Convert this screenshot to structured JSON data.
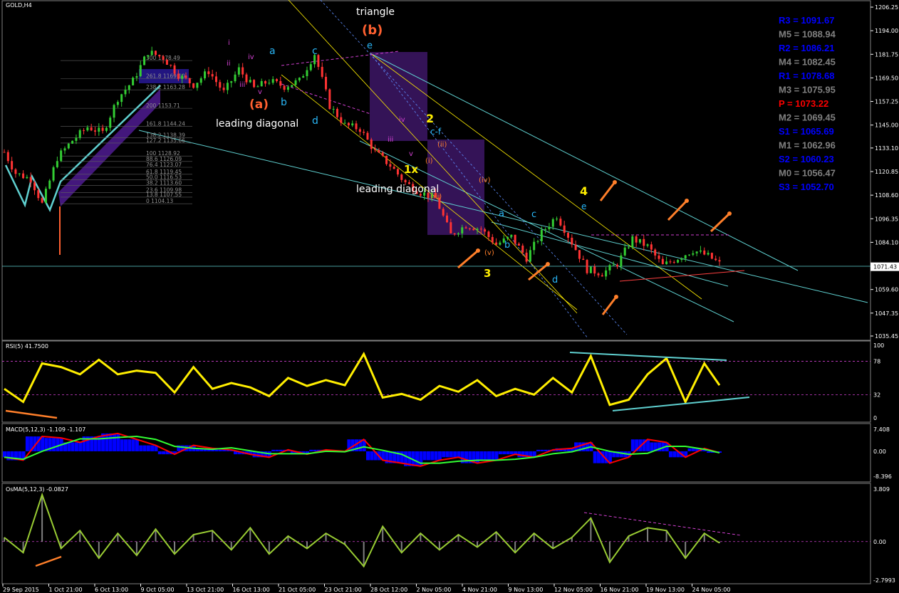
{
  "symbol": "GOLD,H4",
  "colors": {
    "bull": "#33cc33",
    "bear": "#ff3333",
    "rsi": "#ffee00",
    "macd_hist": "#0000ff",
    "macd_main": "#ff0000",
    "macd_signal": "#33ff33",
    "osma": "#99cc33",
    "pivot_r": "#0000ff",
    "pivot_m": "#808080",
    "pivot_p": "#ff0000",
    "channel": "#5fd0d0",
    "arrow": "#ff7f2a"
  },
  "chart_data": [
    {
      "type": "candlestick",
      "title": "GOLD,H4",
      "ylim": [
        1031,
        1210
      ],
      "y_ticks": [
        "1206.25",
        "1194.00",
        "1181.75",
        "1169.50",
        "1157.25",
        "1145.00",
        "1133.10",
        "1120.85",
        "1108.60",
        "1096.35",
        "1084.10",
        "1071.43",
        "1059.60",
        "1047.35",
        "1035.45"
      ],
      "current_price": "1071.43",
      "x_ticks": [
        "29 Sep 2015",
        "1 Oct 21:00",
        "6 Oct 13:00",
        "9 Oct 05:00",
        "13 Oct 21:00",
        "16 Oct 13:00",
        "21 Oct 05:00",
        "23 Oct 21:00",
        "28 Oct 12:00",
        "2 Nov 05:00",
        "4 Nov 21:00",
        "9 Nov 13:00",
        "12 Nov 05:00",
        "16 Nov 21:00",
        "19 Nov 13:00",
        "24 Nov 05:00"
      ],
      "close_path": [
        [
          0,
          1131
        ],
        [
          3,
          1120
        ],
        [
          7,
          1117
        ],
        [
          10,
          1104
        ],
        [
          14,
          1128
        ],
        [
          18,
          1137
        ],
        [
          22,
          1144
        ],
        [
          26,
          1141
        ],
        [
          30,
          1159
        ],
        [
          34,
          1168
        ],
        [
          38,
          1183
        ],
        [
          42,
          1180
        ],
        [
          46,
          1171
        ],
        [
          50,
          1166
        ],
        [
          54,
          1173
        ],
        [
          58,
          1162
        ],
        [
          62,
          1174
        ],
        [
          66,
          1164
        ],
        [
          70,
          1168
        ],
        [
          74,
          1165
        ],
        [
          78,
          1168
        ],
        [
          82,
          1182
        ],
        [
          86,
          1155
        ],
        [
          90,
          1145
        ],
        [
          94,
          1143
        ],
        [
          98,
          1131
        ],
        [
          102,
          1124
        ],
        [
          106,
          1115
        ],
        [
          110,
          1110
        ],
        [
          114,
          1107
        ],
        [
          118,
          1088
        ],
        [
          122,
          1093
        ],
        [
          126,
          1091
        ],
        [
          130,
          1083
        ],
        [
          134,
          1087
        ],
        [
          138,
          1076
        ],
        [
          142,
          1089
        ],
        [
          146,
          1098
        ],
        [
          150,
          1084
        ],
        [
          154,
          1070
        ],
        [
          158,
          1068
        ],
        [
          162,
          1073
        ],
        [
          166,
          1086
        ],
        [
          170,
          1082
        ],
        [
          174,
          1072
        ],
        [
          178,
          1076
        ],
        [
          182,
          1080
        ],
        [
          186,
          1077
        ],
        [
          189,
          1073
        ]
      ],
      "pivots": [
        {
          "label": "R3 = 1091.67",
          "kind": "r"
        },
        {
          "label": "M5 = 1088.94",
          "kind": "m"
        },
        {
          "label": "R2 = 1086.21",
          "kind": "r"
        },
        {
          "label": "M4 = 1082.45",
          "kind": "m"
        },
        {
          "label": "R1 = 1078.68",
          "kind": "r"
        },
        {
          "label": "M3 = 1075.95",
          "kind": "m"
        },
        {
          "label": "P  = 1073.22",
          "kind": "p"
        },
        {
          "label": "M2 = 1069.45",
          "kind": "m"
        },
        {
          "label": "S1 = 1065.69",
          "kind": "r"
        },
        {
          "label": "M1 = 1062.96",
          "kind": "m"
        },
        {
          "label": "S2 = 1060.23",
          "kind": "r"
        },
        {
          "label": "M0 = 1056.47",
          "kind": "m"
        },
        {
          "label": "S3 = 1052.70",
          "kind": "r"
        }
      ],
      "fib_levels": [
        "300 1178.49",
        "261.8 1169.10",
        "238.2 1163.28",
        "200 1153.71",
        "161.8 1144.24",
        "138.2 1138.39",
        "127.2 1135.66",
        "100 1128.92",
        "88.6 1126.09",
        "76.4 1123.07",
        "61.8 1119.45",
        "50.0 1116.53",
        "38.2 1113.60",
        "23.6 1109.98",
        "13.8 1107.55",
        "0 1104.13"
      ],
      "wave_labels": [
        "triangle",
        "(b)",
        "(a)",
        "leading diagonal",
        "leading diagonal",
        "a",
        "b",
        "c",
        "d",
        "e",
        "2",
        "c-f",
        "1x",
        "(ii)",
        "(i)",
        "(iii)",
        "(iv)",
        "(v)",
        "3",
        "4",
        "a",
        "b",
        "c",
        "d",
        "e",
        "i",
        "ii",
        "iii",
        "iv",
        "v",
        "iii",
        "iv",
        "v"
      ]
    },
    {
      "type": "line",
      "title": "RSI(5) 41.7500",
      "ylim": [
        0,
        100
      ],
      "y_ticks": [
        "100",
        "78",
        "32",
        "0"
      ],
      "x": [
        0,
        5,
        10,
        15,
        20,
        25,
        30,
        35,
        40,
        45,
        50,
        55,
        60,
        65,
        70,
        75,
        80,
        85,
        90,
        95,
        100,
        105,
        110,
        115,
        120,
        125,
        130,
        135,
        140,
        145,
        150,
        155,
        160,
        165,
        170,
        175,
        180,
        185,
        189
      ],
      "values": [
        40,
        22,
        75,
        70,
        60,
        80,
        60,
        65,
        62,
        35,
        70,
        40,
        48,
        42,
        30,
        55,
        44,
        52,
        45,
        88,
        28,
        33,
        25,
        44,
        36,
        52,
        30,
        40,
        32,
        55,
        35,
        85,
        18,
        25,
        60,
        82,
        22,
        75,
        45
      ]
    },
    {
      "type": "bar",
      "title": "MACD(5,12,3) -1.109 -1.107",
      "ylim": [
        -8.396,
        7.408
      ],
      "y_ticks": [
        "7.408",
        "0.00",
        "-8.396"
      ],
      "x": [
        0,
        5,
        10,
        15,
        20,
        25,
        30,
        35,
        40,
        45,
        50,
        55,
        60,
        65,
        70,
        75,
        80,
        85,
        90,
        95,
        100,
        105,
        110,
        115,
        120,
        125,
        130,
        135,
        140,
        145,
        150,
        155,
        160,
        165,
        170,
        175,
        180,
        185,
        189
      ],
      "values": [
        -2,
        -3,
        5,
        4.5,
        3,
        5,
        6,
        4,
        2,
        -1,
        2,
        1,
        0.5,
        -1,
        -2,
        0.5,
        -1,
        0.5,
        0,
        4,
        -3,
        -4,
        -5,
        -3,
        -2,
        -4,
        -3,
        -1,
        -2,
        0.5,
        1,
        3,
        -4,
        -2,
        4,
        3,
        -2,
        1,
        -0.5
      ]
    },
    {
      "type": "area",
      "title": "OsMA(5,12,3) -0.0827",
      "ylim": [
        -2.7993,
        3.809
      ],
      "y_ticks": [
        "3.809",
        "0.00",
        "-2.7993"
      ],
      "x": [
        0,
        5,
        10,
        15,
        20,
        25,
        30,
        35,
        40,
        45,
        50,
        55,
        60,
        65,
        70,
        75,
        80,
        85,
        90,
        95,
        100,
        105,
        110,
        115,
        120,
        125,
        130,
        135,
        140,
        145,
        150,
        155,
        160,
        165,
        170,
        175,
        180,
        185,
        189
      ],
      "values": [
        0.3,
        -0.8,
        3.4,
        -0.5,
        0.8,
        -1.2,
        0.6,
        -1,
        0.9,
        -0.9,
        0.5,
        0.8,
        -0.6,
        1,
        -0.9,
        0.4,
        -0.5,
        0.6,
        -0.2,
        -1.8,
        1.1,
        -0.8,
        0.6,
        -0.6,
        0.5,
        -0.4,
        0.7,
        -0.8,
        0.6,
        -0.5,
        0.3,
        1.7,
        -1.5,
        0.4,
        1,
        0.8,
        -1.2,
        0.6,
        -0.1
      ]
    }
  ]
}
